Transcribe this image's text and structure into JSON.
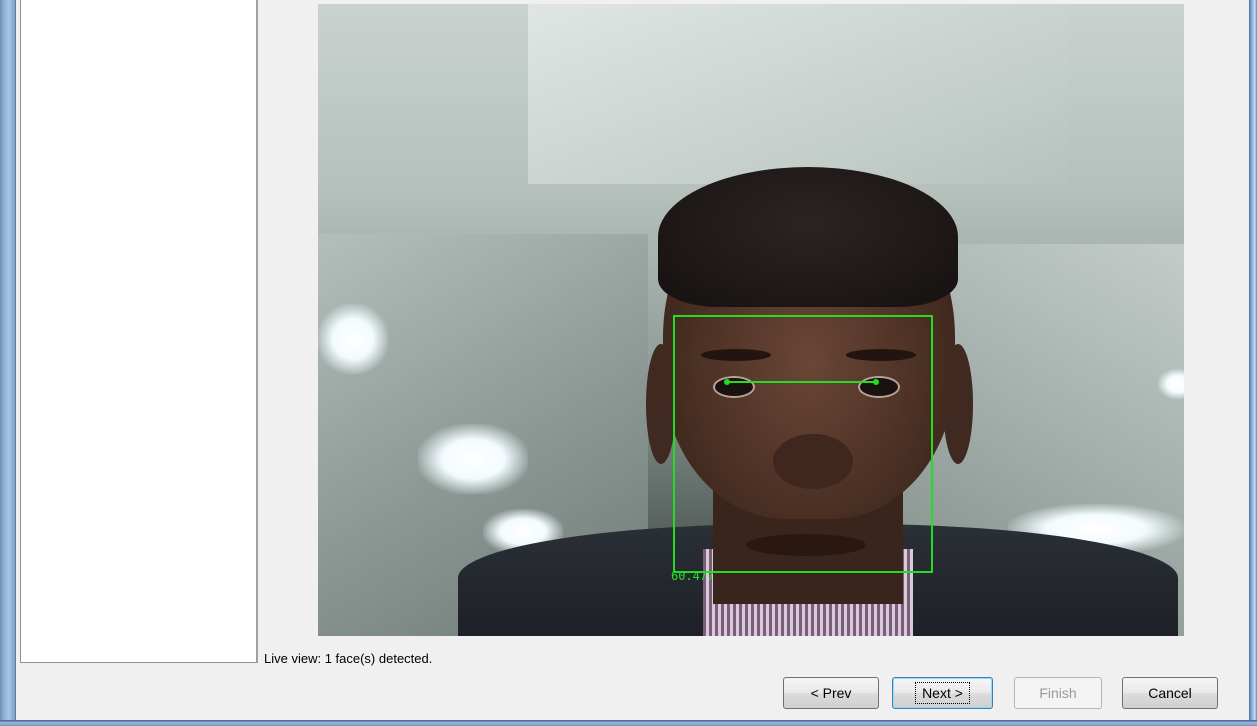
{
  "camera": {
    "face_score": "60.477"
  },
  "status": {
    "text": "Live view: 1 face(s) detected."
  },
  "buttons": {
    "prev": "< Prev",
    "next": "Next >",
    "finish": "Finish",
    "cancel": "Cancel"
  },
  "colors": {
    "detection": "#22dd22",
    "frame": "#6f8fb5"
  }
}
